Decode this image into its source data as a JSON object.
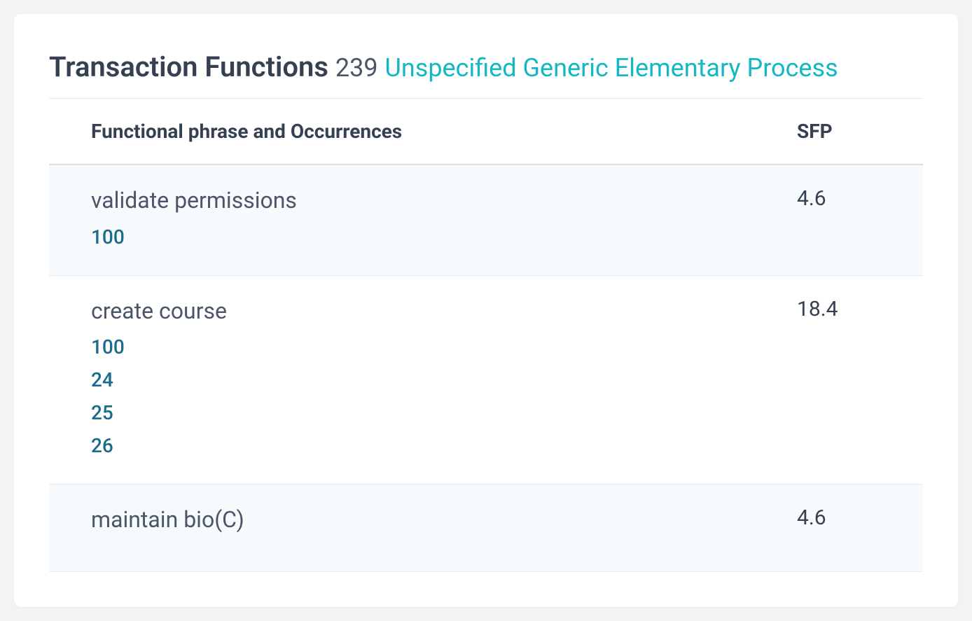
{
  "header": {
    "title": "Transaction Functions",
    "count": "239",
    "subtitle": "Unspecified Generic Elementary Process"
  },
  "columns": {
    "phrase": "Functional phrase and Occurrences",
    "sfp": "SFP"
  },
  "rows": [
    {
      "phrase": "validate permissions",
      "sfp": "4.6",
      "occurrences": [
        "100"
      ]
    },
    {
      "phrase": "create course",
      "sfp": "18.4",
      "occurrences": [
        "100",
        "24",
        "25",
        "26"
      ]
    },
    {
      "phrase": "maintain bio(C)",
      "sfp": "4.6",
      "occurrences": []
    }
  ]
}
